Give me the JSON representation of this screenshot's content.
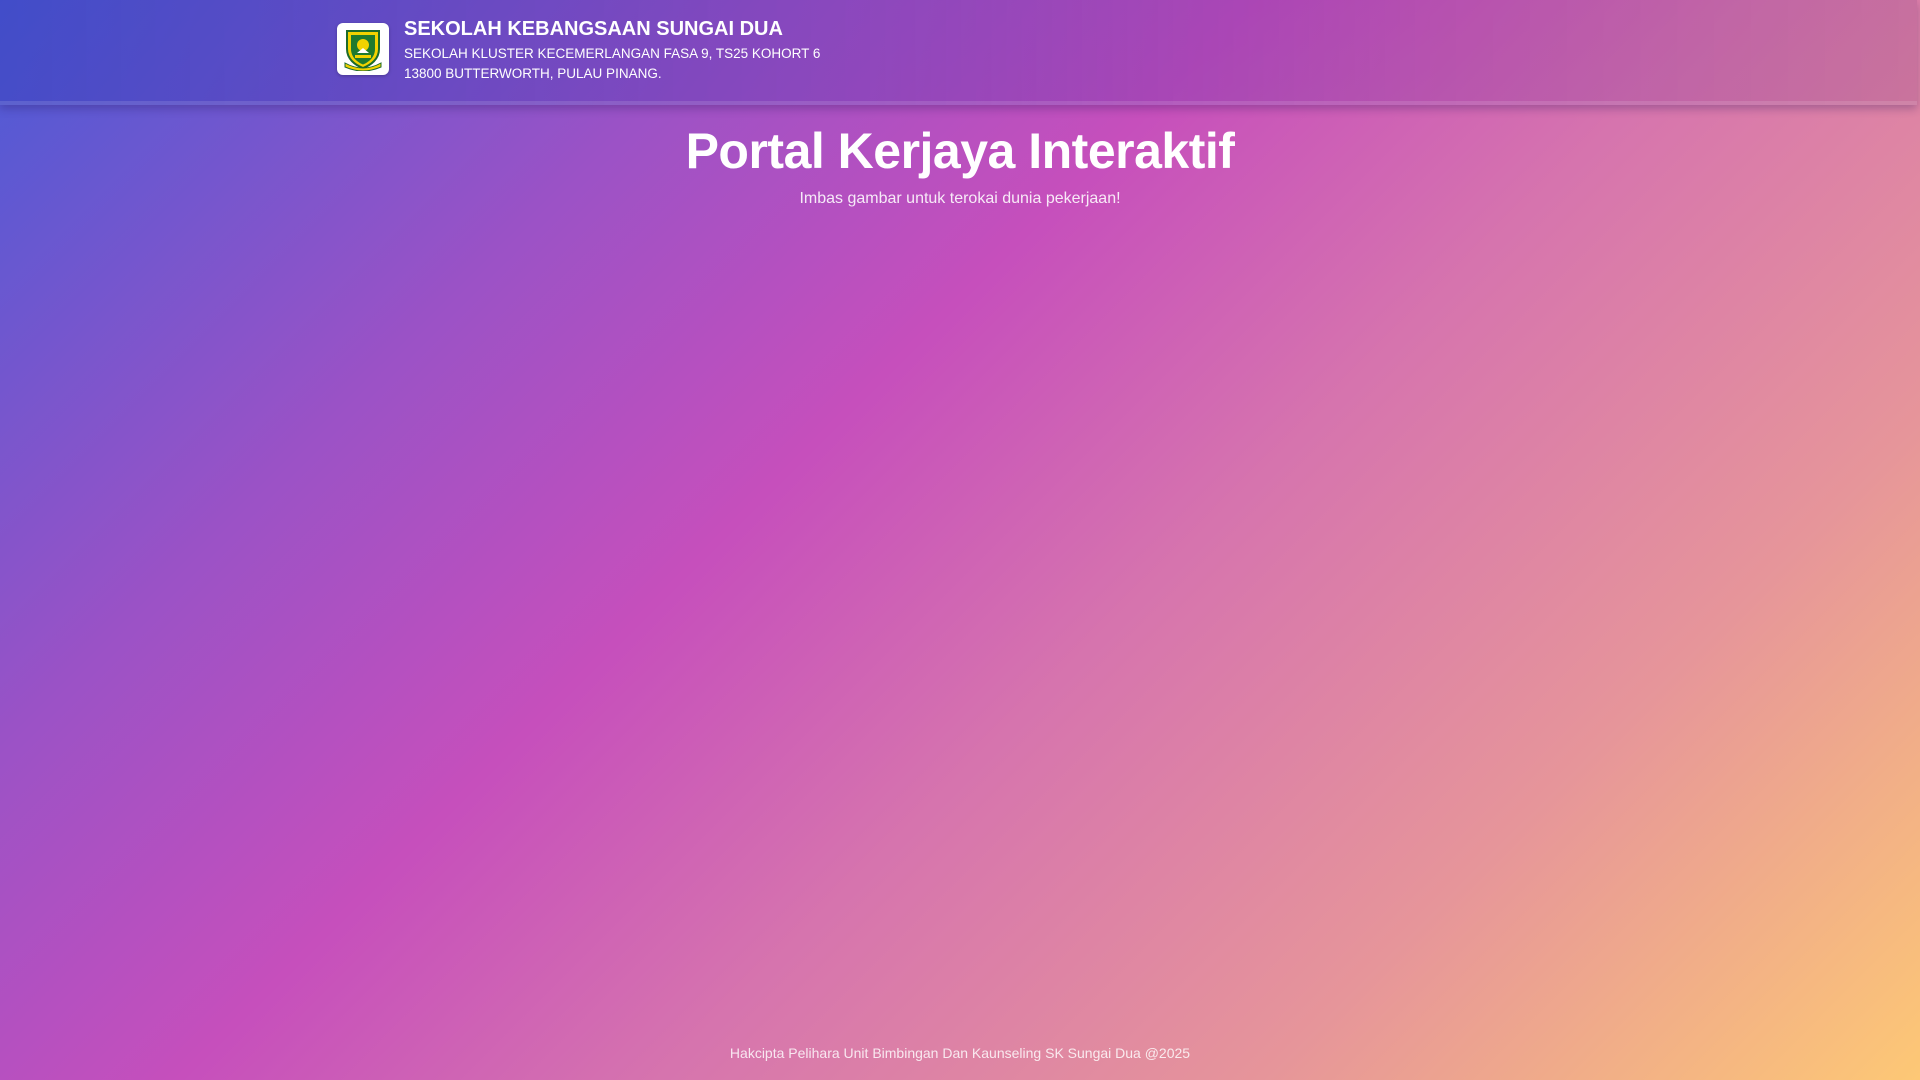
{
  "header": {
    "logo_icon": "school-crest-icon",
    "school_name": "SEKOLAH KEBANGSAAN SUNGAI DUA",
    "address_line1": "SEKOLAH KLUSTER KECEMERLANGAN FASA 9, TS25 KOHORT 6",
    "address_line2": "13800 BUTTERWORTH, PULAU PINANG."
  },
  "main": {
    "title": "Portal Kerjaya Interaktif",
    "subtitle": "Imbas gambar untuk terokai dunia pekerjaan!"
  },
  "footer": {
    "text": "Hakcipta Pelihara Unit Bimbingan Dan Kaunseling SK Sungai Dua @2025"
  },
  "colors": {
    "gradient_start": "#4a5bd6",
    "gradient_mid": "#c64fbc",
    "gradient_end": "#fdc875",
    "text": "#ffffff"
  }
}
